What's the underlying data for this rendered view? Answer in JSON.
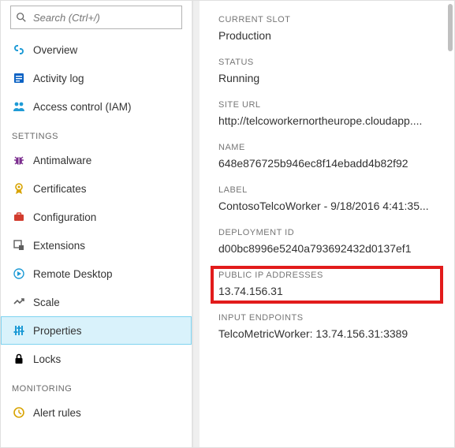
{
  "search": {
    "placeholder": "Search (Ctrl+/)"
  },
  "sidebar": {
    "top_items": [
      {
        "id": "overview",
        "icon": "link-icon",
        "icon_color": "#1f9bd6",
        "label": "Overview"
      },
      {
        "id": "activity-log",
        "icon": "log-icon",
        "icon_color": "#0b62c4",
        "label": "Activity log"
      },
      {
        "id": "access-control",
        "icon": "people-icon",
        "icon_color": "#1f9bd6",
        "label": "Access control (IAM)"
      }
    ],
    "sections": [
      {
        "header": "SETTINGS",
        "items": [
          {
            "id": "antimalware",
            "icon": "bug-icon",
            "icon_color": "#7b2d8e",
            "label": "Antimalware"
          },
          {
            "id": "certificates",
            "icon": "certificate-icon",
            "icon_color": "#d8a300",
            "label": "Certificates"
          },
          {
            "id": "configuration",
            "icon": "briefcase-icon",
            "icon_color": "#d23c2e",
            "label": "Configuration"
          },
          {
            "id": "extensions",
            "icon": "extensions-icon",
            "icon_color": "#5e5e5e",
            "label": "Extensions"
          },
          {
            "id": "remote-desktop",
            "icon": "rdp-icon",
            "icon_color": "#1f9bd6",
            "label": "Remote Desktop"
          },
          {
            "id": "scale",
            "icon": "scale-icon",
            "icon_color": "#5e5e5e",
            "label": "Scale"
          },
          {
            "id": "properties",
            "icon": "properties-icon",
            "icon_color": "#1f9bd6",
            "label": "Properties",
            "selected": true
          },
          {
            "id": "locks",
            "icon": "lock-icon",
            "icon_color": "#000000",
            "label": "Locks"
          }
        ]
      },
      {
        "header": "MONITORING",
        "items": [
          {
            "id": "alert-rules",
            "icon": "alert-icon",
            "icon_color": "#d8a300",
            "label": "Alert rules"
          }
        ]
      }
    ]
  },
  "detail": {
    "fields": [
      {
        "id": "current-slot",
        "label": "CURRENT SLOT",
        "value": "Production"
      },
      {
        "id": "status",
        "label": "STATUS",
        "value": "Running"
      },
      {
        "id": "site-url",
        "label": "SITE URL",
        "value": "http://telcoworkernortheurope.cloudapp...."
      },
      {
        "id": "name",
        "label": "NAME",
        "value": "648e876725b946ec8f14ebadd4b82f92"
      },
      {
        "id": "label",
        "label": "LABEL",
        "value": "ContosoTelcoWorker - 9/18/2016 4:41:35..."
      },
      {
        "id": "deployment-id",
        "label": "DEPLOYMENT ID",
        "value": "d00bc8996e5240a793692432d0137ef1"
      },
      {
        "id": "public-ip",
        "label": "PUBLIC IP ADDRESSES",
        "value": "13.74.156.31",
        "highlighted": true
      },
      {
        "id": "input-endpoints",
        "label": "INPUT ENDPOINTS",
        "value": "TelcoMetricWorker: 13.74.156.31:3389"
      }
    ]
  }
}
